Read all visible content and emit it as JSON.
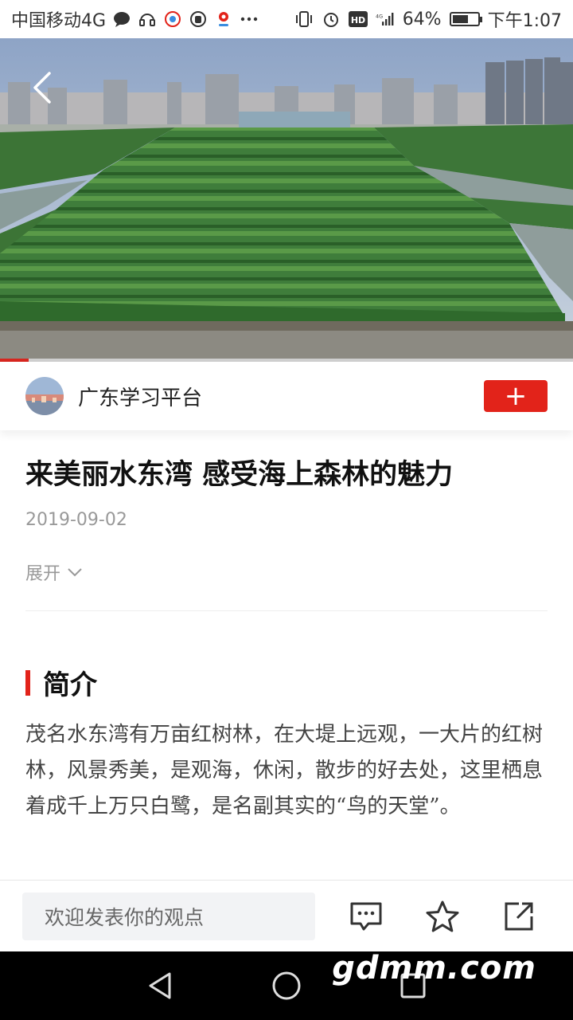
{
  "status_bar": {
    "carrier": "中国移动4G",
    "battery": "64%",
    "battery_level": 0.64,
    "time": "下午1:07",
    "icons": [
      "chat-icon",
      "headset-icon",
      "app-icon",
      "hand-icon",
      "location-icon",
      "more-icon",
      "vibrate-icon",
      "alarm-icon",
      "hd-icon",
      "signal-icon",
      "battery-icon"
    ]
  },
  "video": {
    "progress": 0.05
  },
  "source": {
    "name": "广东学习平台",
    "follow_label": "+"
  },
  "article": {
    "title": "来美丽水东湾 感受海上森林的魅力",
    "date": "2019-09-02",
    "expand_label": "展开",
    "section_title": "简介",
    "intro": "茂名水东湾有万亩红树林，在大堤上远观，一大片的红树林，风景秀美，是观海，休闲，散步的好去处，这里栖息着成千上万只白鹭，是名副其实的“鸟的天堂”。"
  },
  "bottom_bar": {
    "comment_placeholder": "欢迎发表你的观点"
  },
  "watermark": "gdmm.com",
  "colors": {
    "accent": "#e2231a",
    "muted": "#999999"
  }
}
